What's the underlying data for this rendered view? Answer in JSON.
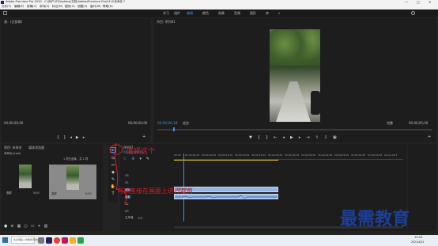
{
  "window": {
    "title": "Adobe Premiere Pro 2020 - C:\\用户\\IT\\Desktop\\文档\\Adobe\\Premiere Pro\\14.0\\未命名 *",
    "controls": [
      "—",
      "□",
      "✕"
    ]
  },
  "menu": [
    "文件(F)",
    "编辑(E)",
    "剪辑(C)",
    "序列(S)",
    "标记(M)",
    "图形(G)",
    "视图(V)",
    "窗口(W)",
    "帮助(H)"
  ],
  "workspaces": {
    "tabs": [
      "学习",
      "组件",
      "编辑",
      "颜色",
      "效果",
      "音频",
      "图形",
      "库"
    ],
    "active_index": 2,
    "more": "»"
  },
  "source_panel": {
    "tab": "源：(无剪辑)",
    "timecode_left": "00;00;00;00",
    "timecode_right": "00;00;00;00"
  },
  "program_monitor": {
    "tab": "节目: 序列01",
    "timecode": "00;00;00;18",
    "fit": "适合",
    "quality": "完整",
    "duration": "00;00;05;00"
  },
  "project_panel": {
    "tabs": [
      "项目: 未命名",
      "媒体浏览器"
    ],
    "path": "未命名.prproj",
    "count": "1 项已选择，共 2 项",
    "items": [
      {
        "name": "竖屏",
        "duration": "5;00"
      },
      {
        "name": "竖屏",
        "duration": "5;00"
      }
    ]
  },
  "tools": [
    "▶",
    "⇆",
    "↔",
    "◆",
    "✎",
    "✋",
    "T"
  ],
  "timeline": {
    "tab": "序列01",
    "timecode": "00;00;00;18",
    "ruler": [
      "00;00",
      "00;00;04;29",
      "00;00;09;29",
      "00;00;14;29",
      "00;00;19;29",
      "00;00;24;29",
      "00;00;29;29",
      "00;00;34;28",
      "00;00;39;29",
      "00;00;44;28",
      "00;00;49;29",
      "00;00;54;28",
      "00;00;59;28",
      "00;01;04;2"
    ],
    "video_tracks": [
      "V3",
      "V2",
      "V1"
    ],
    "audio_tracks": [
      "A1",
      "A2",
      "A3"
    ],
    "master": "主声道",
    "master_value": "0.0",
    "clip_label": "竖屏.mp4 [V]"
  },
  "annotations": {
    "select_tool": "选择这个",
    "instruction": "可以直接在画面上进行裁剪"
  },
  "watermark": "最需教育",
  "taskbar": {
    "search_placeholder": "在这里输入你要搜索的内容",
    "time": "15:20",
    "date": "2021/4/22"
  },
  "colors": {
    "accent": "#3d8fe6",
    "clip": "#8fb4e8",
    "annotation": "#d81f26",
    "watermark": "#1b3f9e"
  }
}
